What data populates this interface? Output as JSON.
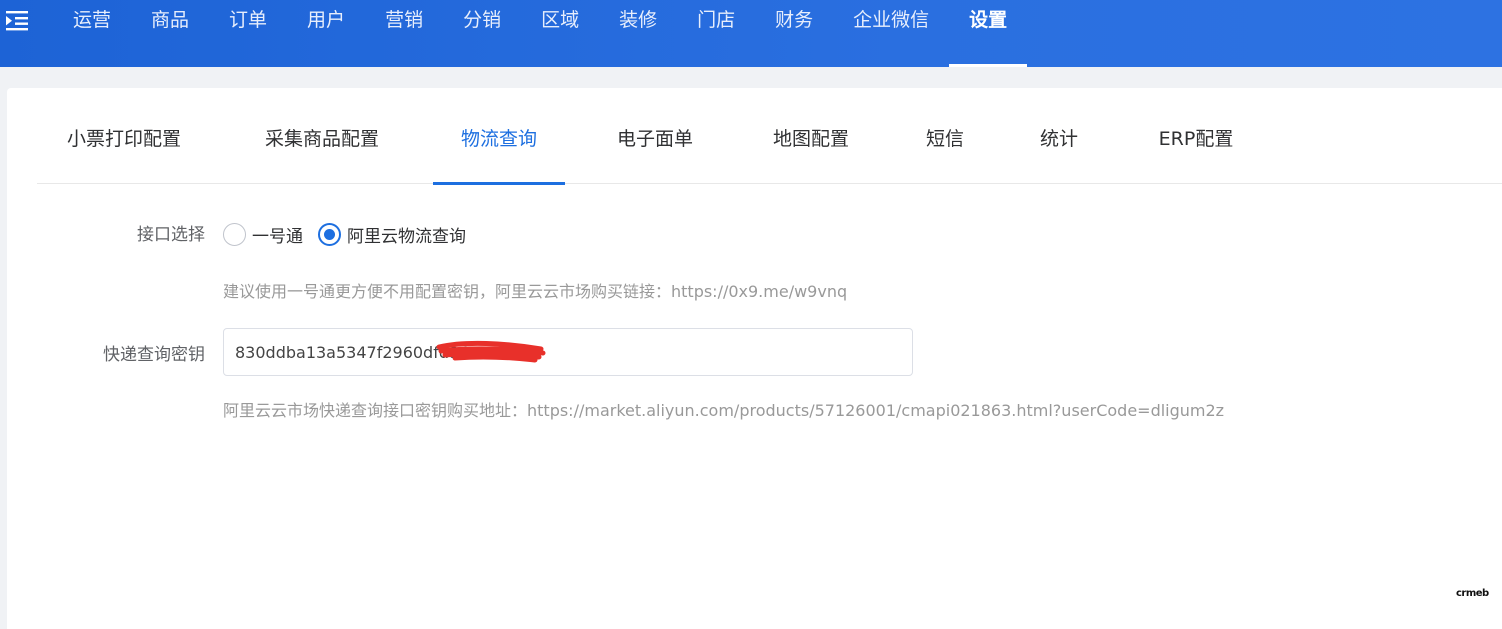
{
  "topnav": {
    "menu_icon": "menu-fold-icon",
    "items": [
      {
        "label": "运营"
      },
      {
        "label": "商品"
      },
      {
        "label": "订单"
      },
      {
        "label": "用户"
      },
      {
        "label": "营销"
      },
      {
        "label": "分销"
      },
      {
        "label": "区域"
      },
      {
        "label": "装修"
      },
      {
        "label": "门店"
      },
      {
        "label": "财务"
      },
      {
        "label": "企业微信"
      },
      {
        "label": "设置"
      }
    ],
    "active": "设置"
  },
  "tabs": {
    "items": [
      {
        "label": "小票打印配置"
      },
      {
        "label": "采集商品配置"
      },
      {
        "label": "物流查询"
      },
      {
        "label": "电子面单"
      },
      {
        "label": "地图配置"
      },
      {
        "label": "短信"
      },
      {
        "label": "统计"
      },
      {
        "label": "ERP配置"
      }
    ],
    "active": "物流查询"
  },
  "form": {
    "interface": {
      "label": "接口选择",
      "options": [
        {
          "label": "一号通",
          "checked": false
        },
        {
          "label": "阿里云物流查询",
          "checked": true
        }
      ],
      "tip": "建议使用一号通更方便不用配置密钥，阿里云云市场购买链接：https://0x9.me/w9vnq"
    },
    "secret": {
      "label": "快递查询密钥",
      "value": "830ddba13a5347f2960dfd949a",
      "tip": "阿里云云市场快递查询接口密钥购买地址：https://market.aliyun.com/products/57126001/cmapi021863.html?userCode=dligum2z"
    }
  },
  "footer": {
    "logo_text": "crmeb"
  },
  "colors": {
    "topbar": "#1d63d6",
    "accent": "#1d6fe0",
    "redaction": "#e8302a"
  }
}
